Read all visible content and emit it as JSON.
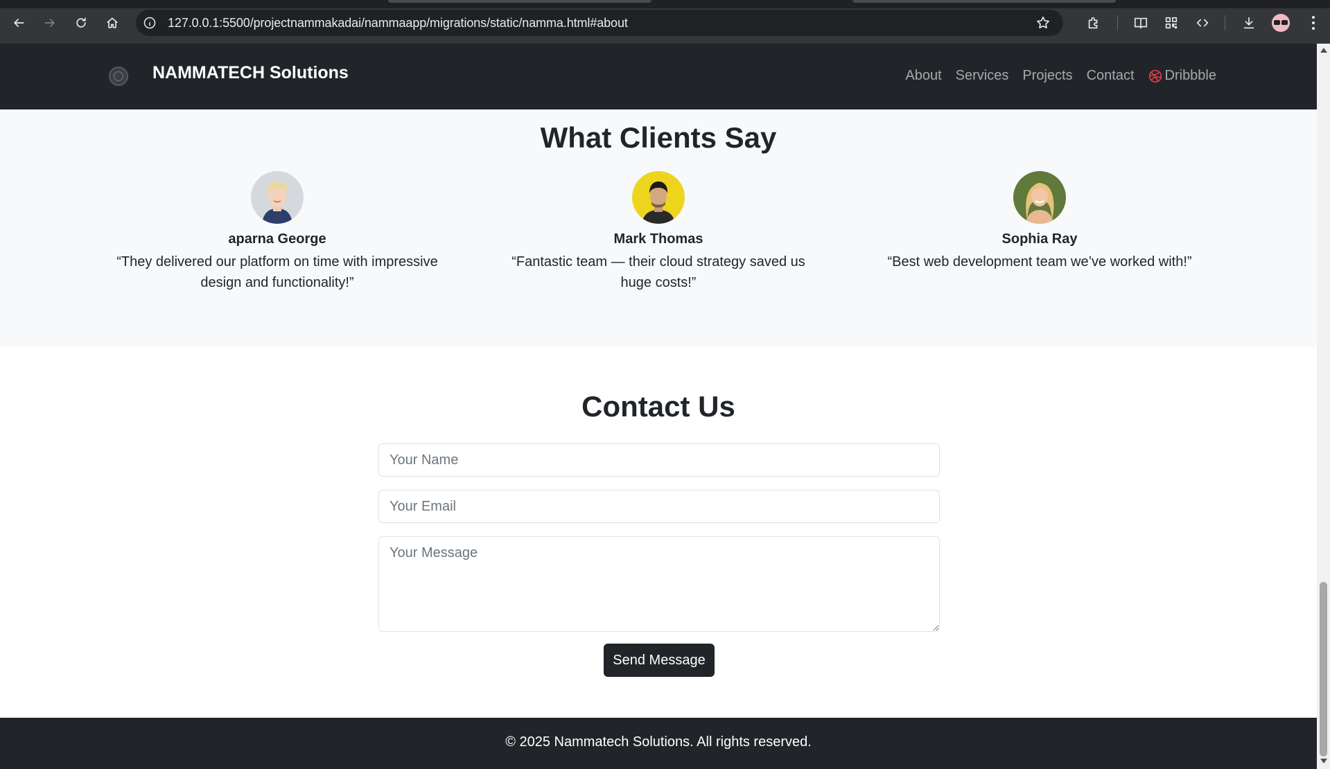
{
  "browser": {
    "url": "127.0.0.1:5500/projectnammakadai/nammaapp/migrations/static/namma.html#about"
  },
  "site": {
    "brand": "NAMMATECH Solutions",
    "nav": [
      {
        "label": "About"
      },
      {
        "label": "Services"
      },
      {
        "label": "Projects"
      },
      {
        "label": "Contact"
      },
      {
        "label": "Dribbble",
        "icon": "dribbble-icon"
      }
    ]
  },
  "testimonials": {
    "title": "What Clients Say",
    "clients": [
      {
        "name": "aparna George",
        "quote": "“They delivered our platform on time with impressive design and functionality!”"
      },
      {
        "name": "Mark Thomas",
        "quote": "“Fantastic team — their cloud strategy saved us huge costs!”"
      },
      {
        "name": "Sophia Ray",
        "quote": "“Best web development team we’ve worked with!”"
      }
    ]
  },
  "contact": {
    "title": "Contact Us",
    "name_placeholder": "Your Name",
    "email_placeholder": "Your Email",
    "message_placeholder": "Your Message",
    "submit_label": "Send Message"
  },
  "footer": {
    "text": "© 2025 Nammatech Solutions. All rights reserved."
  },
  "colors": {
    "dark": "#212529",
    "light_bg": "#f8f9fa",
    "dribbble": "#ea4c89"
  }
}
